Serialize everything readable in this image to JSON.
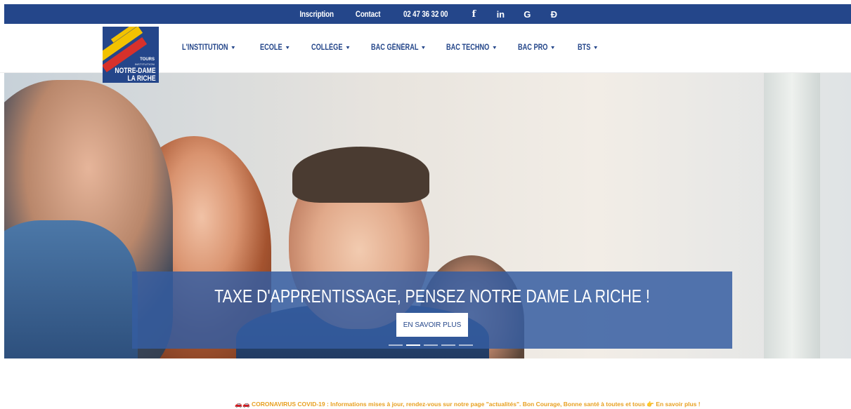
{
  "topbar": {
    "inscription": "Inscription",
    "contact": "Contact",
    "phone": "02 47 36 32 00",
    "icons": [
      "facebook-icon",
      "linkedin-icon",
      "google-icon",
      "ecoledirecte-icon"
    ],
    "facebook_glyph": "f",
    "linkedin_glyph": "in",
    "google_glyph": "G",
    "ed_glyph": "Ð"
  },
  "logo": {
    "tours": "TOURS",
    "institution": "INSTITUTION",
    "line1": "NOTRE-DAME",
    "line2": "LA RICHE"
  },
  "nav": {
    "items": [
      {
        "label": "L'INSTITUTION"
      },
      {
        "label": "ECOLE"
      },
      {
        "label": "COLLÈGE"
      },
      {
        "label": "BAC GÉNÉRAL"
      },
      {
        "label": "BAC TECHNO"
      },
      {
        "label": "BAC PRO"
      },
      {
        "label": "BTS"
      }
    ]
  },
  "hero": {
    "title": "TAXE D'APPRENTISSAGE, PENSEZ NOTRE DAME LA RICHE !",
    "button": "EN SAVOIR PLUS",
    "slides": 5,
    "active_slide": 2
  },
  "notice": {
    "emoji_left": "🚗🚗",
    "text": "CORONAVIRUS COVID-19 : Informations mises à jour, rendez-vous sur notre page \"actualités\". Bon Courage, Bonne santé à toutes et tous",
    "emoji_right": "👉",
    "link": "En savoir plus !"
  },
  "colors": {
    "brand_blue": "#24468a",
    "banner_blue": "#355da1",
    "notice_orange": "#e8a020"
  }
}
